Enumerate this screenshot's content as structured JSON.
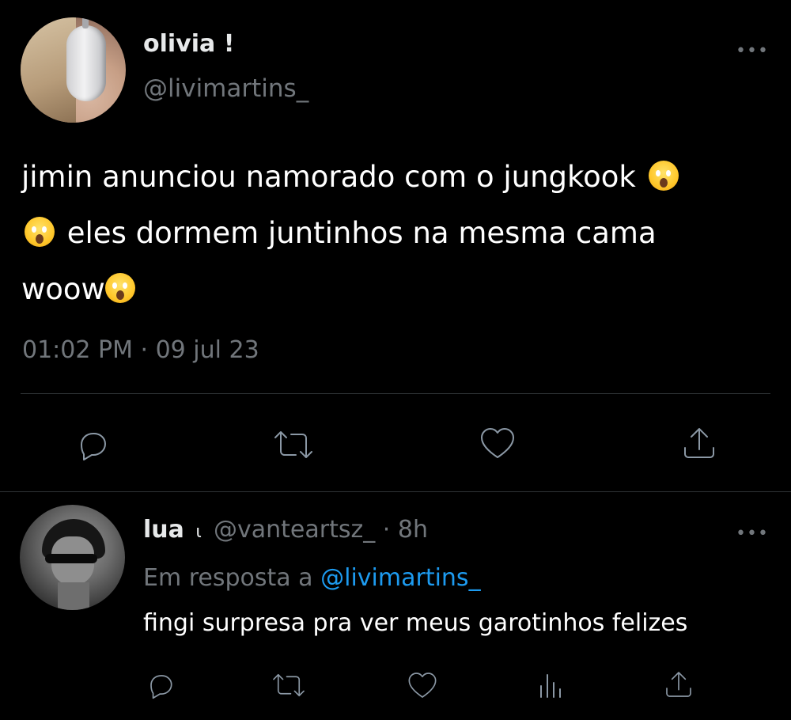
{
  "tweet": {
    "author_name": "olivia !",
    "author_handle": "@livimartins_",
    "more_label": "•••",
    "text_line1": "jimin anunciou namorado com o jungkook",
    "text_line2": "eles dormem juntinhos na mesma cama",
    "text_line3": "woow",
    "timestamp": "01:02 PM · 09 jul 23",
    "emoji_name": "scream-emoji",
    "actions": [
      "reply-icon",
      "retweet-icon",
      "like-icon",
      "share-icon"
    ]
  },
  "reply": {
    "author_name": "lua",
    "author_symbol": "ɩ",
    "author_handle": "@vanteartsz_",
    "time": "· 8h",
    "more_label": "•••",
    "reply_to_prefix": "Em resposta a",
    "reply_to_handle": "@livimartins_",
    "text": "fingi surpresa pra ver meus garotinhos felizes",
    "actions": [
      "reply-icon",
      "retweet-icon",
      "like-icon",
      "views-icon",
      "share-icon"
    ]
  },
  "colors": {
    "background": "#000000",
    "text": "#ffffff",
    "secondary": "#71767b",
    "link": "#1d9bf0",
    "divider": "#2f3336"
  }
}
